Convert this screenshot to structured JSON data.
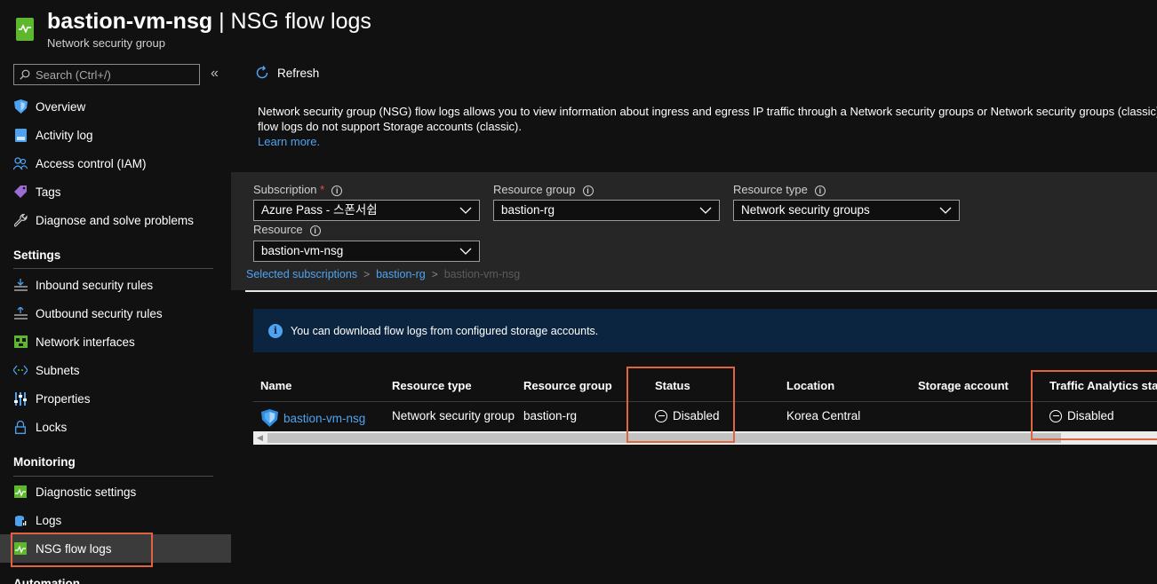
{
  "header": {
    "resource_name": "bastion-vm-nsg",
    "separator": " | ",
    "page_name": "NSG flow logs",
    "subtitle": "Network security group"
  },
  "sidebar": {
    "search_placeholder": "Search (Ctrl+/)",
    "collapse_glyph": "«",
    "items": [
      {
        "label": "Overview",
        "icon": "shield-icon"
      },
      {
        "label": "Activity log",
        "icon": "activity-log-icon"
      },
      {
        "label": "Access control (IAM)",
        "icon": "iam-people-icon"
      },
      {
        "label": "Tags",
        "icon": "tag-icon"
      },
      {
        "label": "Diagnose and solve problems",
        "icon": "wrench-icon"
      }
    ],
    "settings_title": "Settings",
    "settings_items": [
      {
        "label": "Inbound security rules",
        "icon": "inbound-rules-icon"
      },
      {
        "label": "Outbound security rules",
        "icon": "outbound-rules-icon"
      },
      {
        "label": "Network interfaces",
        "icon": "network-interface-icon"
      },
      {
        "label": "Subnets",
        "icon": "subnets-icon"
      },
      {
        "label": "Properties",
        "icon": "properties-icon"
      },
      {
        "label": "Locks",
        "icon": "lock-icon"
      }
    ],
    "monitoring_title": "Monitoring",
    "monitoring_items": [
      {
        "label": "Diagnostic settings",
        "icon": "diagnostic-settings-icon"
      },
      {
        "label": "Logs",
        "icon": "logs-icon"
      },
      {
        "label": "NSG flow logs",
        "icon": "nsg-flow-logs-icon",
        "active": true
      }
    ],
    "automation_title": "Automation"
  },
  "toolbar": {
    "refresh_label": "Refresh"
  },
  "description": {
    "line1": "Network security group (NSG) flow logs allows you to view information about ingress and egress IP traffic through a Network security groups or Network security groups (classic). NSG",
    "line2": "flow logs do not support Storage accounts (classic).",
    "learn_more": "Learn more."
  },
  "filters": {
    "subscription_label": "Subscription",
    "subscription_required": "*",
    "subscription_value": "Azure Pass - 스폰서쉽",
    "resource_group_label": "Resource group",
    "resource_group_value": "bastion-rg",
    "resource_type_label": "Resource type",
    "resource_type_value": "Network security groups",
    "resource_label": "Resource",
    "resource_value": "bastion-vm-nsg",
    "info_glyph": "i"
  },
  "breadcrumb": {
    "items": [
      "Selected subscriptions",
      "bastion-rg",
      "bastion-vm-nsg"
    ],
    "separator": ">"
  },
  "info_banner": {
    "icon_glyph": "i",
    "text": "You can download flow logs from configured storage accounts."
  },
  "table": {
    "columns": [
      "Name",
      "Resource type",
      "Resource group",
      "Status",
      "Location",
      "Storage account",
      "Traffic Analytics status"
    ],
    "rows": [
      {
        "name": "bastion-vm-nsg",
        "resource_type": "Network security group",
        "resource_group": "bastion-rg",
        "status": "Disabled",
        "location": "Korea Central",
        "storage_account": "",
        "traffic_analytics": "Disabled"
      }
    ],
    "scroll_left_glyph": "◀"
  },
  "colors": {
    "background": "#111111",
    "accent_blue": "#4ea3f0",
    "highlight_orange": "#e0623f",
    "nsg_green": "#5db82e",
    "info_banner_bg": "#0b2440"
  }
}
